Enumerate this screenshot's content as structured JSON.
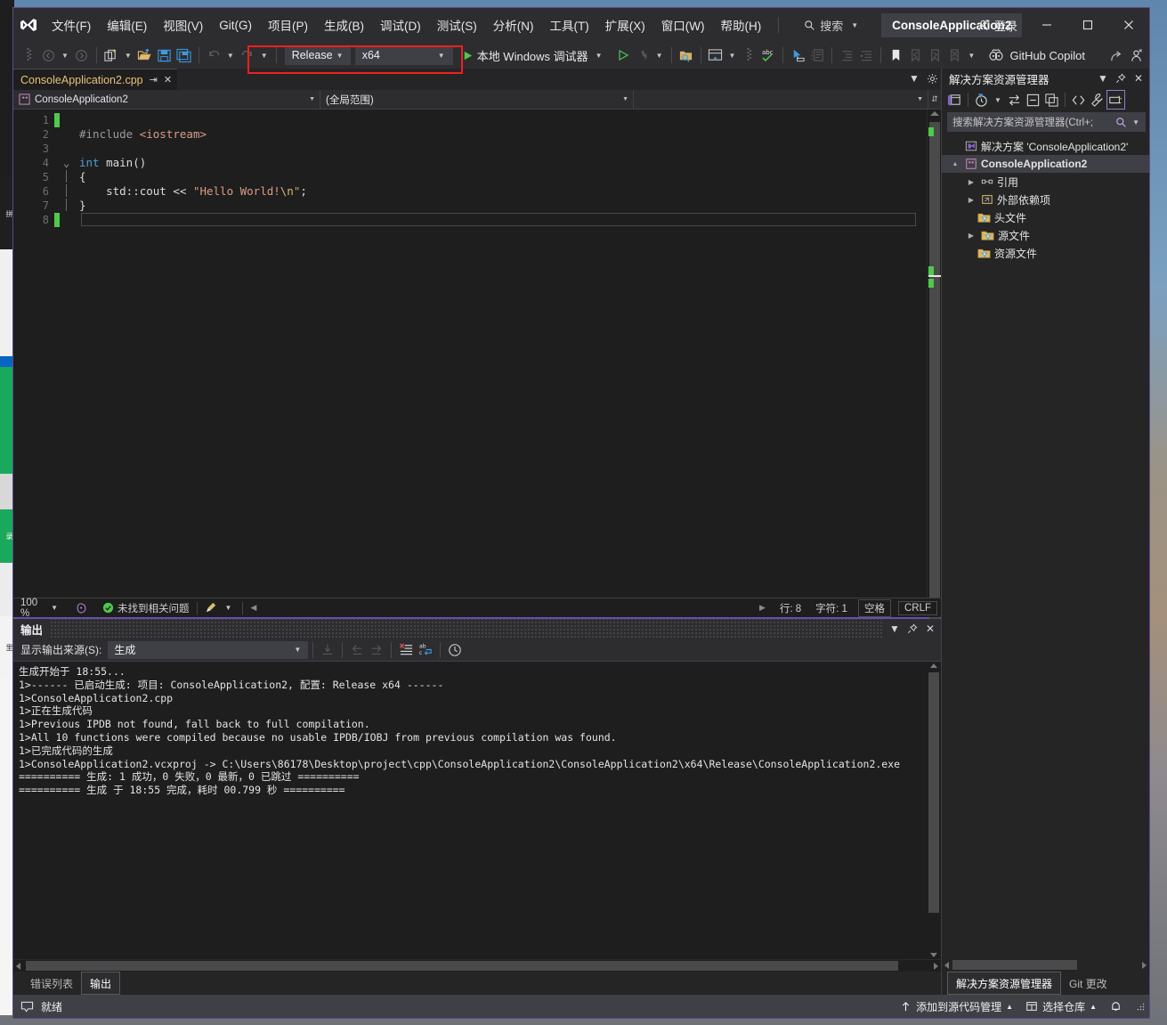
{
  "window": {
    "title": "ConsoleApplication2",
    "signin_label": "登录",
    "copilot_label": "GitHub Copilot"
  },
  "menubar": {
    "items": [
      {
        "label": "文件(F)"
      },
      {
        "label": "编辑(E)"
      },
      {
        "label": "视图(V)"
      },
      {
        "label": "Git(G)"
      },
      {
        "label": "项目(P)"
      },
      {
        "label": "生成(B)"
      },
      {
        "label": "调试(D)"
      },
      {
        "label": "测试(S)"
      },
      {
        "label": "分析(N)"
      },
      {
        "label": "工具(T)"
      },
      {
        "label": "扩展(X)"
      },
      {
        "label": "窗口(W)"
      },
      {
        "label": "帮助(H)"
      }
    ],
    "search_placeholder": "搜索"
  },
  "toolbar": {
    "configuration": "Release",
    "platform": "x64",
    "run_label": "本地 Windows 调试器"
  },
  "editor": {
    "tab_name": "ConsoleApplication2.cpp",
    "nav_project": "ConsoleApplication2",
    "nav_scope": "(全局范围)",
    "nav_member": "",
    "line_numbers": [
      "1",
      "2",
      "3",
      "4",
      "5",
      "6",
      "7",
      "8"
    ],
    "code_lines": [
      "",
      "#include <iostream>",
      "",
      "int main()",
      "{",
      "    std::cout << \"Hello World!\\n\";",
      "}",
      ""
    ],
    "status": {
      "zoom": "100 %",
      "issues": "未找到相关问题",
      "line_label": "行: 8",
      "char_label": "字符: 1",
      "indent": "空格",
      "eol": "CRLF"
    }
  },
  "output": {
    "panel_title": "输出",
    "source_label": "显示输出来源(S):",
    "source_value": "生成",
    "lines": [
      "生成开始于 18:55...",
      "1>------ 已启动生成: 项目: ConsoleApplication2, 配置: Release x64 ------",
      "1>ConsoleApplication2.cpp",
      "1>正在生成代码",
      "1>Previous IPDB not found, fall back to full compilation.",
      "1>All 10 functions were compiled because no usable IPDB/IOBJ from previous compilation was found.",
      "1>已完成代码的生成",
      "1>ConsoleApplication2.vcxproj -> C:\\Users\\86178\\Desktop\\project\\cpp\\ConsoleApplication2\\ConsoleApplication2\\x64\\Release\\ConsoleApplication2.exe",
      "========== 生成: 1 成功，0 失败，0 最新，0 已跳过 ==========",
      "========== 生成 于 18:55 完成，耗时 00.799 秒 =========="
    ],
    "bottom_tabs": [
      {
        "label": "错误列表",
        "active": false
      },
      {
        "label": "输出",
        "active": true
      }
    ]
  },
  "solution_explorer": {
    "title": "解决方案资源管理器",
    "search_placeholder": "搜索解决方案资源管理器(Ctrl+;",
    "tree": [
      {
        "label": "解决方案 'ConsoleApplication2'",
        "indent": 0,
        "arrow": "",
        "icon": "solution-icon",
        "bold": false,
        "selected": false
      },
      {
        "label": "ConsoleApplication2",
        "indent": 1,
        "arrow": "▲",
        "icon": "cpp-project-icon",
        "bold": true,
        "selected": true
      },
      {
        "label": "引用",
        "indent": 2,
        "arrow": "▶",
        "icon": "references-icon",
        "bold": false,
        "selected": false
      },
      {
        "label": "外部依赖项",
        "indent": 2,
        "arrow": "▶",
        "icon": "external-deps-icon",
        "bold": false,
        "selected": false
      },
      {
        "label": "头文件",
        "indent": 2,
        "arrow": "",
        "icon": "filter-folder-icon",
        "bold": false,
        "selected": false
      },
      {
        "label": "源文件",
        "indent": 2,
        "arrow": "▶",
        "icon": "filter-folder-icon",
        "bold": false,
        "selected": false
      },
      {
        "label": "资源文件",
        "indent": 2,
        "arrow": "",
        "icon": "filter-folder-icon",
        "bold": false,
        "selected": false
      }
    ],
    "bottom_tabs": [
      {
        "label": "解决方案资源管理器",
        "active": true
      },
      {
        "label": "Git 更改",
        "active": false
      }
    ]
  },
  "statusbar": {
    "ready": "就绪",
    "source_control": "添加到源代码管理",
    "select_repo": "选择仓库"
  },
  "colors": {
    "accent_purple": "#6a4fa8",
    "highlight_red": "#f01f1f",
    "run_green": "#4ec94e",
    "tab_orange": "#e8c07a"
  }
}
